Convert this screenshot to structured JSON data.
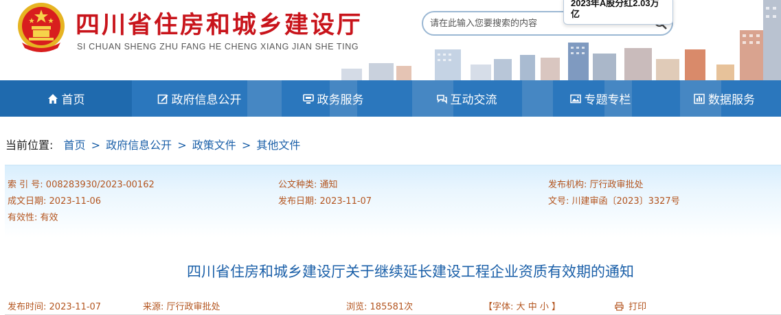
{
  "header": {
    "site_title": "四川省住房和城乡建设厅",
    "site_pinyin": "SI CHUAN SHENG ZHU FANG HE CHENG XIANG JIAN SHE TING",
    "search_placeholder": "请在此输入您要搜索的内容",
    "popup_text": "2023年A股分红2.03万亿",
    "emblem_icon": "national-emblem-icon",
    "search_icon": "search-icon"
  },
  "nav": {
    "items": [
      {
        "label": "首页",
        "icon": "home-icon"
      },
      {
        "label": "政府信息公开",
        "icon": "edit-icon"
      },
      {
        "label": "政务服务",
        "icon": "monitor-icon"
      },
      {
        "label": "互动交流",
        "icon": "chat-icon"
      },
      {
        "label": "专题专栏",
        "icon": "picture-icon"
      },
      {
        "label": "数据服务",
        "icon": "chart-icon"
      }
    ]
  },
  "breadcrumb": {
    "label": "当前位置:",
    "items": [
      "首页",
      "政府信息公开",
      "政策文件",
      "其他文件"
    ],
    "separator": ">"
  },
  "meta": {
    "index_label": "索 引 号:",
    "index_value": "008283930/2023-00162",
    "doc_type_label": "公文种类:",
    "doc_type_value": "通知",
    "publisher_label": "发布机构:",
    "publisher_value": "厅行政审批处",
    "created_label": "成文日期:",
    "created_value": "2023-11-06",
    "published_label": "发布日期:",
    "published_value": "2023-11-07",
    "doc_no_label": "文号:",
    "doc_no_value": "川建审函〔2023〕3327号",
    "validity_label": "有效性:",
    "validity_value": "有效"
  },
  "article": {
    "title": "四川省住房和城乡建设厅关于继续延长建设工程企业资质有效期的通知",
    "publish_time_label": "发布时间:",
    "publish_time_value": "2023-11-07",
    "source_label": "来源:",
    "source_value": "厅行政审批处",
    "views_label": "浏览:",
    "views_value": "185581次",
    "font_label": "【字体:",
    "font_large": "大",
    "font_medium": "中",
    "font_small": "小",
    "font_close": "】",
    "print_label": "打印",
    "print_icon": "printer-icon"
  },
  "colors": {
    "title_red": "#c8141b",
    "nav_blue": "#2b77bd",
    "link_blue": "#1a5fa8",
    "meta_text": "#b3541e"
  }
}
